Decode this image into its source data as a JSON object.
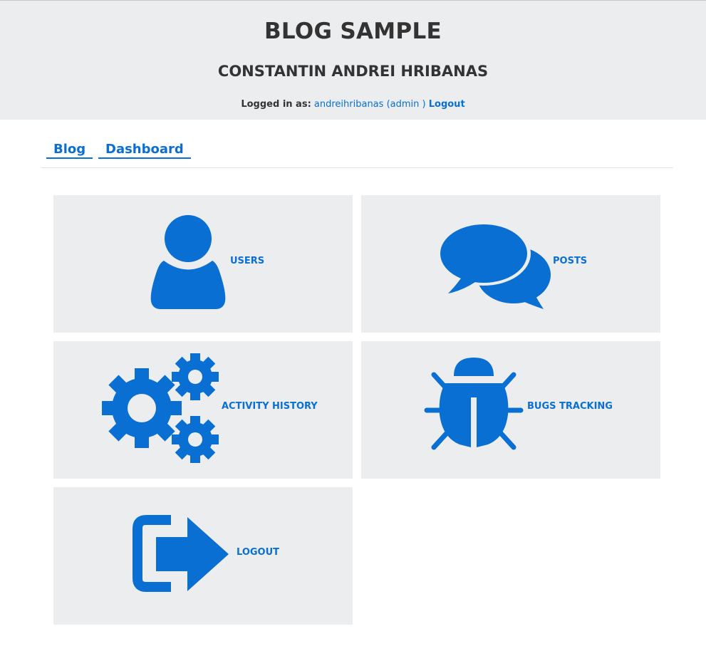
{
  "header": {
    "title": "BLOG SAMPLE",
    "subtitle": "CONSTANTIN ANDREI HRIBANAS",
    "logged_in_label": "Logged in as:",
    "username": "andreihribanas",
    "role": "(admin )",
    "logout_label": "Logout"
  },
  "nav": {
    "blog_label": "Blog",
    "dashboard_label": "Dashboard"
  },
  "tiles": {
    "users": {
      "label": "USERS",
      "icon": "user-icon"
    },
    "posts": {
      "label": "POSTS",
      "icon": "chat-bubbles-icon"
    },
    "activity": {
      "label": "ACTIVITY HISTORY",
      "icon": "gears-icon"
    },
    "bugs": {
      "label": "BUGS TRACKING",
      "icon": "bug-icon"
    },
    "logout": {
      "label": "LOGOUT",
      "icon": "logout-icon"
    }
  },
  "colors": {
    "accent": "#0a6fd3",
    "tile_background": "#ecedef",
    "header_background": "#ecedef",
    "text": "#333333"
  }
}
